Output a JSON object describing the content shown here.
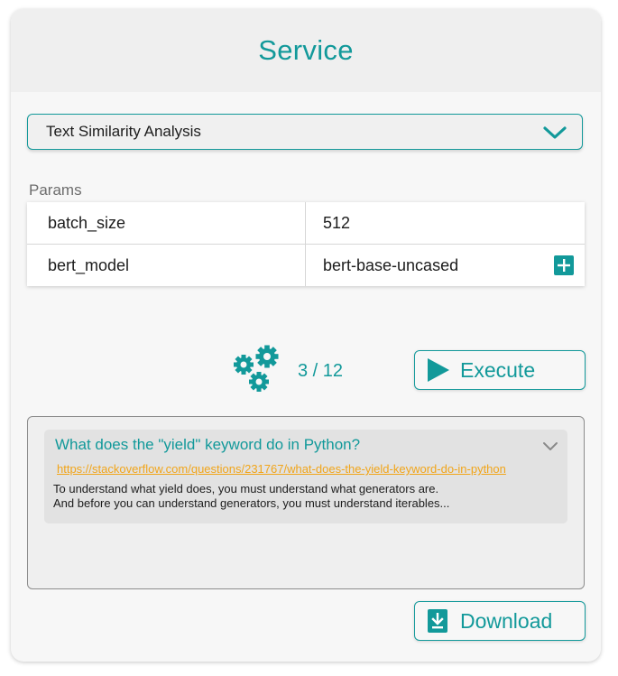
{
  "header": {
    "title": "Service"
  },
  "service_select": {
    "selected": "Text Similarity Analysis",
    "icon": "chevron-down-icon"
  },
  "params": {
    "label": "Params",
    "rows": [
      {
        "key": "batch_size",
        "value": "512"
      },
      {
        "key": "bert_model",
        "value": "bert-base-uncased"
      }
    ],
    "add_icon": "plus-icon"
  },
  "progress": {
    "text": "3 / 12",
    "current": 3,
    "total": 12,
    "icon": "gears-icon"
  },
  "execute_button": {
    "label": "Execute",
    "icon": "play-icon"
  },
  "results": [
    {
      "title": "What does the \"yield\" keyword do in Python?",
      "link": "https://stackoverflow.com/questions/231767/what-does-the-yield-keyword-do-in-python",
      "snippet_line1": "To understand what yield does, you must understand what generators are.",
      "snippet_line2": "And before you can understand generators, you must understand iterables..."
    }
  ],
  "download_button": {
    "label": "Download",
    "icon": "download-icon"
  },
  "colors": {
    "accent": "#12999a",
    "link": "#f1a51a",
    "card_bg": "#f7f7f7",
    "header_bg": "#efefef"
  }
}
